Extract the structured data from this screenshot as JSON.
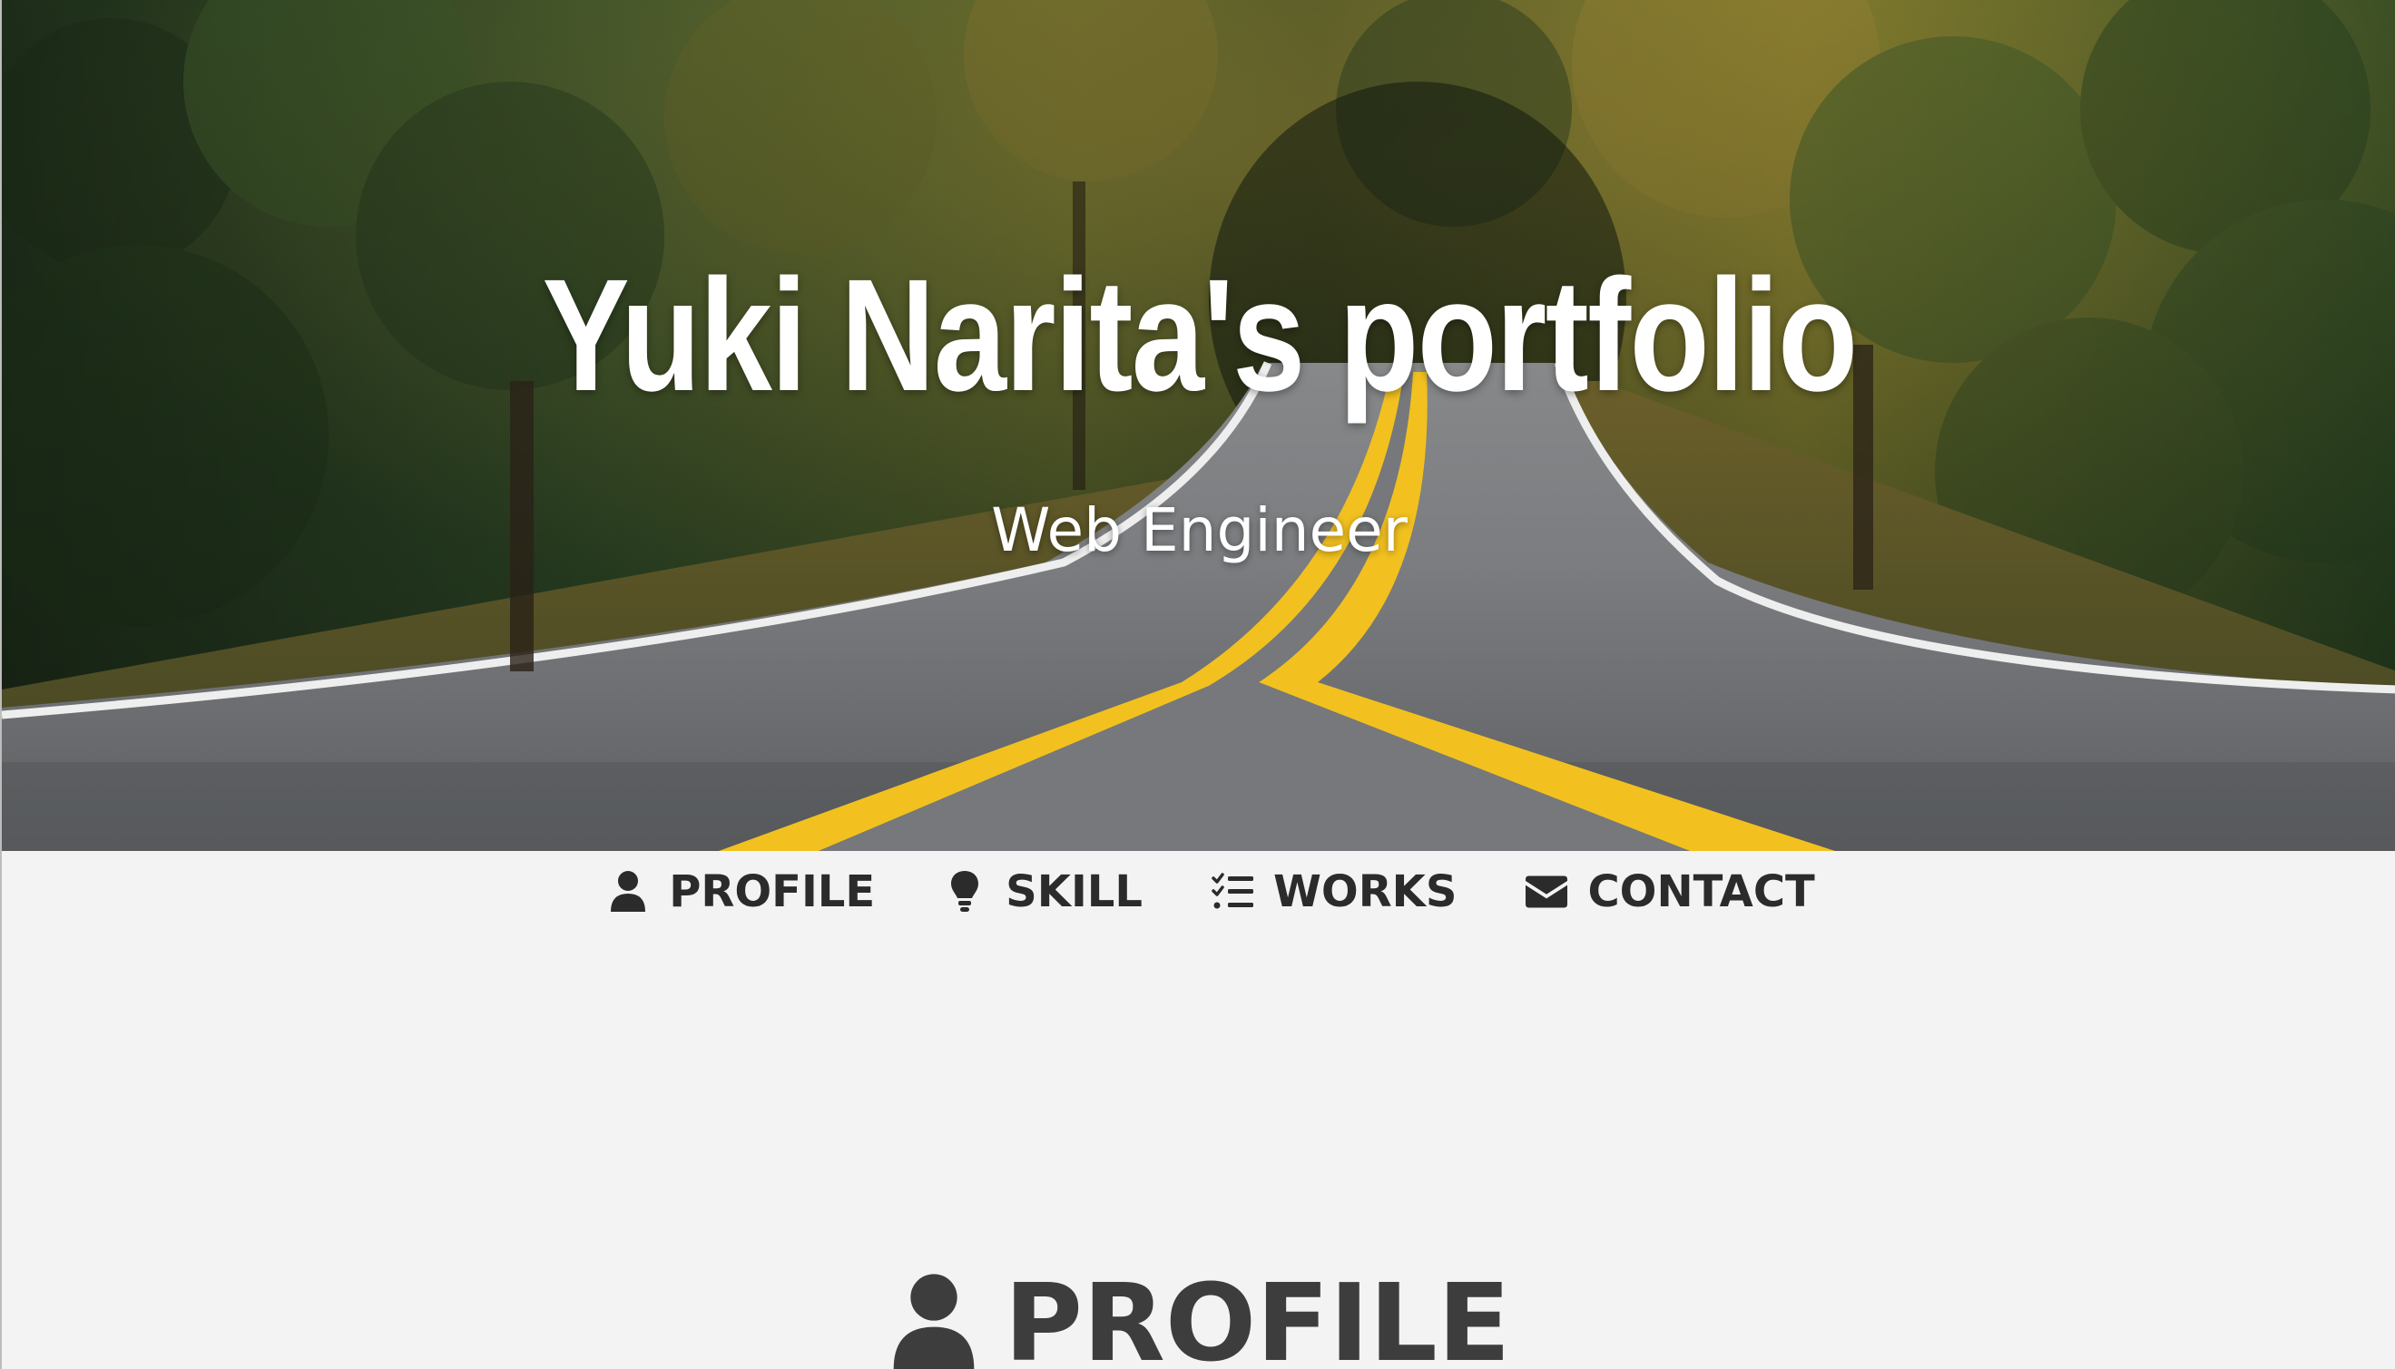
{
  "hero": {
    "title": "Yuki Narita's portfolio",
    "subtitle": "Web Engineer"
  },
  "nav": {
    "items": [
      {
        "label": "PROFILE",
        "icon": "user-icon"
      },
      {
        "label": "SKILL",
        "icon": "lightbulb-icon"
      },
      {
        "label": "WORKS",
        "icon": "tasks-list-icon"
      },
      {
        "label": "CONTACT",
        "icon": "envelope-icon"
      }
    ]
  },
  "section": {
    "title": "PROFILE",
    "icon": "user-icon"
  },
  "colors": {
    "page_background": "#f3f3f3",
    "nav_text": "#2b2b2b",
    "section_heading": "#3d3d3d",
    "hero_text": "#ffffff",
    "road_line": "#f2c11f"
  }
}
